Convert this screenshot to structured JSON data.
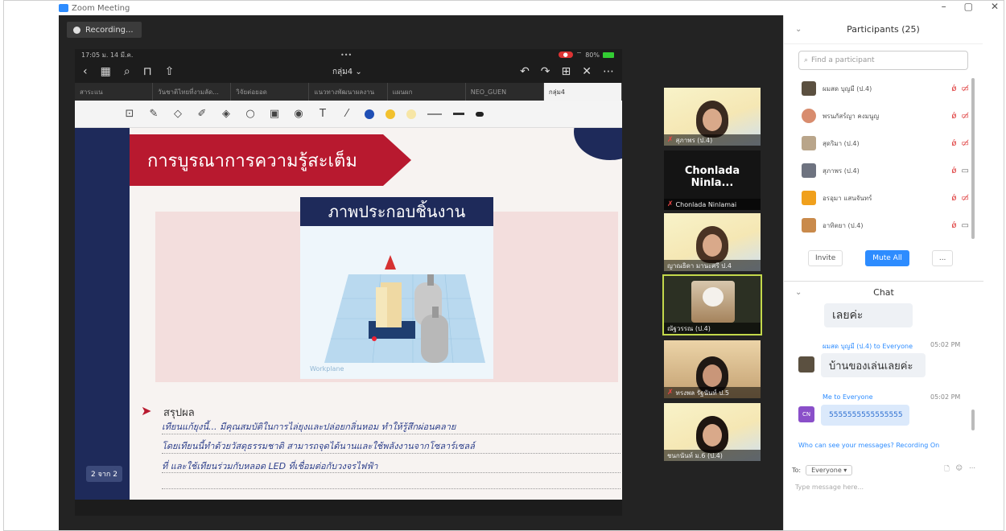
{
  "window": {
    "title": "Zoom Meeting",
    "controls": [
      "–",
      "▢",
      "✕"
    ]
  },
  "recording": {
    "label": "Recording..."
  },
  "ipad": {
    "status_time": "17:05",
    "status_date": "ม. 14 มี.ค.",
    "dots": "•••",
    "battery": "80%",
    "doc_title": "กลุ่ม4 ⌄",
    "tabs": [
      "สาระแน",
      "วันชาติไทยที่งามลัด...",
      "วิจัยต่อยอด",
      "แนวทางพัฒนาผลงาน",
      "แผนผก",
      "NEO_GUEN",
      "กลุ่ม4"
    ],
    "page_badge": "2 จาก 2"
  },
  "slide": {
    "banner": "การบูรณาการความรู้สะเต็ม",
    "image_title": "ภาพประกอบชิ้นงาน",
    "workplane": "Workplane",
    "conclusion_label": "สรุปผล",
    "handwriting": [
      "เทียนแก้ยุงนี้... มีคุณสมบัติในการไล่ยุงและปล่อยกลิ่นหอม ทำให้รู้สึกผ่อนคลาย",
      "โดยเทียนนี้ทำด้วยวัสดุธรรมชาติ สามารถจุดได้นานและใช้พลังงานจากโซลาร์เซลล์",
      "ที่ และใช้เทียนร่วมกับหลอด LED ที่เชื่อมต่อกับวงจรไฟฟ้า"
    ]
  },
  "videos": [
    {
      "name": "สุภาพร (ป.4)",
      "kind": "face"
    },
    {
      "name": "Chonlada Ninlamai",
      "display": "Chonlada  Ninla...",
      "kind": "name"
    },
    {
      "name": "ญาณธิดา มานะศรี ป.4",
      "kind": "face"
    },
    {
      "name": "ณัฐวรรณ (ป.4)",
      "kind": "dog"
    },
    {
      "name": "ทรงพล รัฐนันท์ ป.5",
      "kind": "face2"
    },
    {
      "name": "ชนกนันท์ ม.6 (ป.4)",
      "kind": "face"
    }
  ],
  "participants": {
    "header": "Participants (25)",
    "search_placeholder": "Find a participant",
    "items": [
      {
        "name": "ผมสด บุญมี (ป.4)",
        "cam_on": false
      },
      {
        "name": "พรนภัสร์ญา คงมนูญ",
        "cam_on": false
      },
      {
        "name": "สุดริมา (ป.4)",
        "cam_on": false
      },
      {
        "name": "สุภาพร (ป.4)",
        "cam_on": true
      },
      {
        "name": "อรอุมา แสนจันทร์",
        "cam_on": false
      },
      {
        "name": "อาทิตยา (ป.4)",
        "cam_on": true
      }
    ],
    "invite": "Invite",
    "mute_all": "Mute All",
    "more": "..."
  },
  "chat": {
    "header": "Chat",
    "messages": [
      {
        "text": "เลยค่ะ"
      },
      {
        "meta": "ผมสด บุญมี (ป.4) to Everyone",
        "time": "05:02 PM",
        "text": "บ้านของเล่นเลยค่ะ"
      },
      {
        "meta": "Me to Everyone",
        "time": "05:02 PM",
        "text": "5555555555555555",
        "avatar": "CN"
      }
    ],
    "who_can_see": "Who can see your messages? Recording On",
    "to_label": "To:",
    "to_value": "Everyone ▾",
    "input_placeholder": "Type message here..."
  }
}
